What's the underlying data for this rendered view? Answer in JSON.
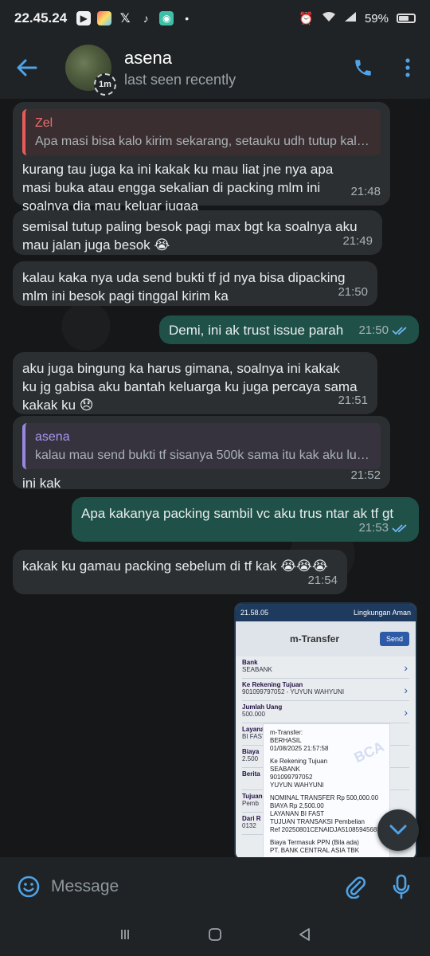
{
  "status_bar": {
    "time": "22.45.24",
    "battery": "59%",
    "icons": [
      "notification-app-icon",
      "x-app-icon",
      "tiktok-icon",
      "chat-app-icon",
      "alarm-icon",
      "wifi-icon",
      "signal-icon",
      "battery-icon"
    ]
  },
  "header": {
    "name": "asena",
    "last_seen": "last seen recently",
    "avatar_badge": "1m"
  },
  "messages": [
    {
      "direction": "in",
      "reply_name": "Zel",
      "reply_text": "Apa masi bisa kalo kirim sekarang, setauku udh tutup kalo j...",
      "lines": [
        "kurang tau juga ka ini kakak ku mau liat jne nya apa",
        "masi buka atau engga sekalian di packing mlm ini",
        "soalnya dia mau keluar jugaa"
      ],
      "time": "21:48"
    },
    {
      "direction": "in",
      "lines": [
        "semisal tutup paling besok pagi max bgt ka soalnya aku",
        "mau jalan juga besok 😭"
      ],
      "time": "21:49"
    },
    {
      "direction": "in",
      "lines": [
        "kalau kaka nya uda send bukti tf jd nya bisa dipacking",
        "mlm ini besok pagi tinggal kirim ka"
      ],
      "time": "21:50"
    },
    {
      "direction": "out",
      "lines": [
        "Demi, ini ak trust issue parah"
      ],
      "time": "21:50"
    },
    {
      "direction": "in",
      "lines": [
        "aku juga bingung ka harus gimana, soalnya ini kakak",
        "ku jg gabisa aku bantah keluarga ku juga percaya sama",
        "kakak ku 😞"
      ],
      "time": "21:51"
    },
    {
      "direction": "in",
      "reply_name": "asena",
      "reply_text": "kalau mau send bukti tf sisanya 500k sama itu kak aku lupa...",
      "lines": [
        "ini kak"
      ],
      "time": "21:52"
    },
    {
      "direction": "out",
      "lines": [
        "Apa kakanya packing sambil vc aku trus ntar ak tf gt"
      ],
      "time": "21:53"
    },
    {
      "direction": "in",
      "lines": [
        "kakak ku gamau packing sebelum di tf kak 😭😭😭"
      ],
      "time": "21:54"
    }
  ],
  "attachment": {
    "status_time": "21.58.05",
    "status_right": "Lingkungan Aman",
    "app_title": "m-Transfer",
    "send_label": "Send",
    "rows": [
      {
        "label": "Bank",
        "value": "SEABANK"
      },
      {
        "label": "Ke Rekening Tujuan",
        "value": "901099797052 - YUYUN WAHYUNI"
      },
      {
        "label": "Jumlah Uang",
        "value": "500.000"
      },
      {
        "label": "Layanan",
        "value": "BI FAST"
      },
      {
        "label": "Biaya",
        "value": "2.500"
      },
      {
        "label": "Berita",
        "value": ""
      },
      {
        "label": "Tujuan",
        "value": "Pemb"
      },
      {
        "label": "Dari R",
        "value": "0132"
      }
    ],
    "receipt_lines": [
      "m-Transfer:",
      "BERHASIL",
      "01/08/2025 21:57:58",
      "",
      "Ke Rekening Tujuan",
      "SEABANK",
      "901099797052",
      "YUYUN WAHYUNI",
      "",
      "NOMINAL TRANSFER Rp 500,000.00",
      "BIAYA Rp 2,500.00",
      "LAYANAN BI FAST",
      "TUJUAN TRANSAKSI Pembelian",
      "Ref 20250801CENAIDJA51085945687",
      "",
      "Biaya Termasuk PPN (Bila ada)",
      "PT. BANK CENTRAL ASIA TBK"
    ],
    "watermark": "BCA"
  },
  "input": {
    "placeholder": "Message"
  },
  "colors": {
    "accent": "#4fa3e6",
    "incoming_bubble": "#2b2f31",
    "outgoing_bubble": "#1f5148",
    "check": "#6fb7f5"
  }
}
